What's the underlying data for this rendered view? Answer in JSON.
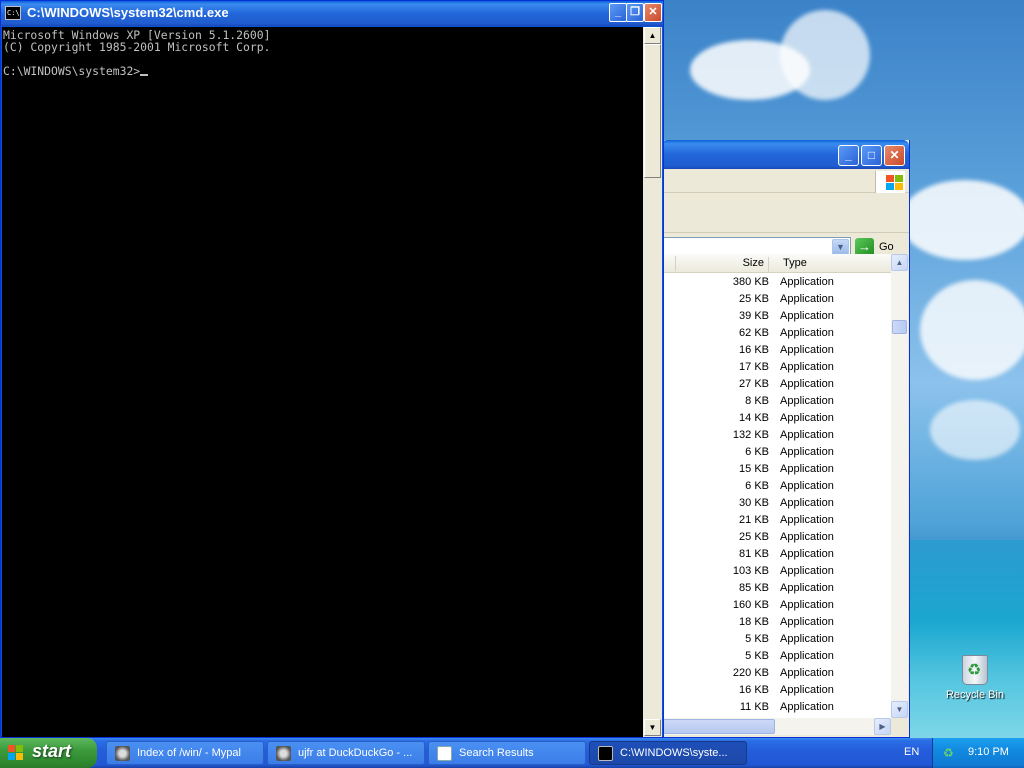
{
  "cmd": {
    "title": "C:\\WINDOWS\\system32\\cmd.exe",
    "icon_label": "C:\\",
    "lines": [
      "Microsoft Windows XP [Version 5.1.2600]",
      "(C) Copyright 1985-2001 Microsoft Corp.",
      "",
      "C:\\WINDOWS\\system32>"
    ]
  },
  "explorer": {
    "go_label": "Go",
    "columns": {
      "size": "Size",
      "type": "Type"
    },
    "rows": [
      {
        "size": "380 KB",
        "type": "Application"
      },
      {
        "size": "25 KB",
        "type": "Application"
      },
      {
        "size": "39 KB",
        "type": "Application"
      },
      {
        "size": "62 KB",
        "type": "Application"
      },
      {
        "size": "16 KB",
        "type": "Application"
      },
      {
        "size": "17 KB",
        "type": "Application"
      },
      {
        "size": "27 KB",
        "type": "Application"
      },
      {
        "size": "8 KB",
        "type": "Application"
      },
      {
        "size": "14 KB",
        "type": "Application"
      },
      {
        "size": "132 KB",
        "type": "Application"
      },
      {
        "size": "6 KB",
        "type": "Application"
      },
      {
        "size": "15 KB",
        "type": "Application"
      },
      {
        "size": "6 KB",
        "type": "Application"
      },
      {
        "size": "30 KB",
        "type": "Application"
      },
      {
        "size": "21 KB",
        "type": "Application"
      },
      {
        "size": "25 KB",
        "type": "Application"
      },
      {
        "size": "81 KB",
        "type": "Application"
      },
      {
        "size": "103 KB",
        "type": "Application"
      },
      {
        "size": "85 KB",
        "type": "Application"
      },
      {
        "size": "160 KB",
        "type": "Application"
      },
      {
        "size": "18 KB",
        "type": "Application"
      },
      {
        "size": "5 KB",
        "type": "Application"
      },
      {
        "size": "5 KB",
        "type": "Application"
      },
      {
        "size": "220 KB",
        "type": "Application"
      },
      {
        "size": "16 KB",
        "type": "Application"
      },
      {
        "size": "11 KB",
        "type": "Application"
      }
    ]
  },
  "desktop": {
    "recycle_bin_label": "Recycle Bin"
  },
  "taskbar": {
    "start_label": "start",
    "tasks": [
      {
        "label": "Index of /win/ - Mypal",
        "icon": "mypal-icon",
        "active": false
      },
      {
        "label": "ujfr at DuckDuckGo - ...",
        "icon": "mypal-icon",
        "active": false
      },
      {
        "label": "Search Results",
        "icon": "search-results-icon",
        "active": false
      },
      {
        "label": "C:\\WINDOWS\\syste...",
        "icon": "cmd-icon",
        "active": true
      }
    ],
    "language": "EN",
    "clock": "9:10 PM"
  },
  "colors": {
    "titlebar_blue": "#2266d9",
    "taskbar_blue": "#245edb",
    "start_green": "#3c9a3c",
    "console_bg": "#000000",
    "console_fg": "#c0c0c0"
  }
}
